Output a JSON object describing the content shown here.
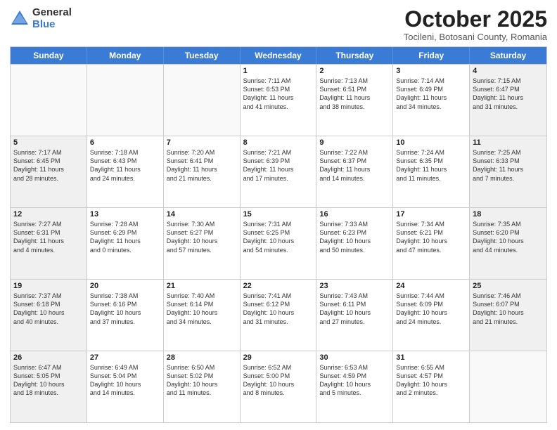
{
  "header": {
    "logo_general": "General",
    "logo_blue": "Blue",
    "month_title": "October 2025",
    "location": "Tocileni, Botosani County, Romania"
  },
  "weekdays": [
    "Sunday",
    "Monday",
    "Tuesday",
    "Wednesday",
    "Thursday",
    "Friday",
    "Saturday"
  ],
  "rows": [
    [
      {
        "day": "",
        "info": "",
        "shaded": false,
        "empty": true
      },
      {
        "day": "",
        "info": "",
        "shaded": false,
        "empty": true
      },
      {
        "day": "",
        "info": "",
        "shaded": false,
        "empty": true
      },
      {
        "day": "1",
        "info": "Sunrise: 7:11 AM\nSunset: 6:53 PM\nDaylight: 11 hours\nand 41 minutes.",
        "shaded": false,
        "empty": false
      },
      {
        "day": "2",
        "info": "Sunrise: 7:13 AM\nSunset: 6:51 PM\nDaylight: 11 hours\nand 38 minutes.",
        "shaded": false,
        "empty": false
      },
      {
        "day": "3",
        "info": "Sunrise: 7:14 AM\nSunset: 6:49 PM\nDaylight: 11 hours\nand 34 minutes.",
        "shaded": false,
        "empty": false
      },
      {
        "day": "4",
        "info": "Sunrise: 7:15 AM\nSunset: 6:47 PM\nDaylight: 11 hours\nand 31 minutes.",
        "shaded": true,
        "empty": false
      }
    ],
    [
      {
        "day": "5",
        "info": "Sunrise: 7:17 AM\nSunset: 6:45 PM\nDaylight: 11 hours\nand 28 minutes.",
        "shaded": true,
        "empty": false
      },
      {
        "day": "6",
        "info": "Sunrise: 7:18 AM\nSunset: 6:43 PM\nDaylight: 11 hours\nand 24 minutes.",
        "shaded": false,
        "empty": false
      },
      {
        "day": "7",
        "info": "Sunrise: 7:20 AM\nSunset: 6:41 PM\nDaylight: 11 hours\nand 21 minutes.",
        "shaded": false,
        "empty": false
      },
      {
        "day": "8",
        "info": "Sunrise: 7:21 AM\nSunset: 6:39 PM\nDaylight: 11 hours\nand 17 minutes.",
        "shaded": false,
        "empty": false
      },
      {
        "day": "9",
        "info": "Sunrise: 7:22 AM\nSunset: 6:37 PM\nDaylight: 11 hours\nand 14 minutes.",
        "shaded": false,
        "empty": false
      },
      {
        "day": "10",
        "info": "Sunrise: 7:24 AM\nSunset: 6:35 PM\nDaylight: 11 hours\nand 11 minutes.",
        "shaded": false,
        "empty": false
      },
      {
        "day": "11",
        "info": "Sunrise: 7:25 AM\nSunset: 6:33 PM\nDaylight: 11 hours\nand 7 minutes.",
        "shaded": true,
        "empty": false
      }
    ],
    [
      {
        "day": "12",
        "info": "Sunrise: 7:27 AM\nSunset: 6:31 PM\nDaylight: 11 hours\nand 4 minutes.",
        "shaded": true,
        "empty": false
      },
      {
        "day": "13",
        "info": "Sunrise: 7:28 AM\nSunset: 6:29 PM\nDaylight: 11 hours\nand 0 minutes.",
        "shaded": false,
        "empty": false
      },
      {
        "day": "14",
        "info": "Sunrise: 7:30 AM\nSunset: 6:27 PM\nDaylight: 10 hours\nand 57 minutes.",
        "shaded": false,
        "empty": false
      },
      {
        "day": "15",
        "info": "Sunrise: 7:31 AM\nSunset: 6:25 PM\nDaylight: 10 hours\nand 54 minutes.",
        "shaded": false,
        "empty": false
      },
      {
        "day": "16",
        "info": "Sunrise: 7:33 AM\nSunset: 6:23 PM\nDaylight: 10 hours\nand 50 minutes.",
        "shaded": false,
        "empty": false
      },
      {
        "day": "17",
        "info": "Sunrise: 7:34 AM\nSunset: 6:21 PM\nDaylight: 10 hours\nand 47 minutes.",
        "shaded": false,
        "empty": false
      },
      {
        "day": "18",
        "info": "Sunrise: 7:35 AM\nSunset: 6:20 PM\nDaylight: 10 hours\nand 44 minutes.",
        "shaded": true,
        "empty": false
      }
    ],
    [
      {
        "day": "19",
        "info": "Sunrise: 7:37 AM\nSunset: 6:18 PM\nDaylight: 10 hours\nand 40 minutes.",
        "shaded": true,
        "empty": false
      },
      {
        "day": "20",
        "info": "Sunrise: 7:38 AM\nSunset: 6:16 PM\nDaylight: 10 hours\nand 37 minutes.",
        "shaded": false,
        "empty": false
      },
      {
        "day": "21",
        "info": "Sunrise: 7:40 AM\nSunset: 6:14 PM\nDaylight: 10 hours\nand 34 minutes.",
        "shaded": false,
        "empty": false
      },
      {
        "day": "22",
        "info": "Sunrise: 7:41 AM\nSunset: 6:12 PM\nDaylight: 10 hours\nand 31 minutes.",
        "shaded": false,
        "empty": false
      },
      {
        "day": "23",
        "info": "Sunrise: 7:43 AM\nSunset: 6:11 PM\nDaylight: 10 hours\nand 27 minutes.",
        "shaded": false,
        "empty": false
      },
      {
        "day": "24",
        "info": "Sunrise: 7:44 AM\nSunset: 6:09 PM\nDaylight: 10 hours\nand 24 minutes.",
        "shaded": false,
        "empty": false
      },
      {
        "day": "25",
        "info": "Sunrise: 7:46 AM\nSunset: 6:07 PM\nDaylight: 10 hours\nand 21 minutes.",
        "shaded": true,
        "empty": false
      }
    ],
    [
      {
        "day": "26",
        "info": "Sunrise: 6:47 AM\nSunset: 5:05 PM\nDaylight: 10 hours\nand 18 minutes.",
        "shaded": true,
        "empty": false
      },
      {
        "day": "27",
        "info": "Sunrise: 6:49 AM\nSunset: 5:04 PM\nDaylight: 10 hours\nand 14 minutes.",
        "shaded": false,
        "empty": false
      },
      {
        "day": "28",
        "info": "Sunrise: 6:50 AM\nSunset: 5:02 PM\nDaylight: 10 hours\nand 11 minutes.",
        "shaded": false,
        "empty": false
      },
      {
        "day": "29",
        "info": "Sunrise: 6:52 AM\nSunset: 5:00 PM\nDaylight: 10 hours\nand 8 minutes.",
        "shaded": false,
        "empty": false
      },
      {
        "day": "30",
        "info": "Sunrise: 6:53 AM\nSunset: 4:59 PM\nDaylight: 10 hours\nand 5 minutes.",
        "shaded": false,
        "empty": false
      },
      {
        "day": "31",
        "info": "Sunrise: 6:55 AM\nSunset: 4:57 PM\nDaylight: 10 hours\nand 2 minutes.",
        "shaded": false,
        "empty": false
      },
      {
        "day": "",
        "info": "",
        "shaded": false,
        "empty": true
      }
    ]
  ]
}
